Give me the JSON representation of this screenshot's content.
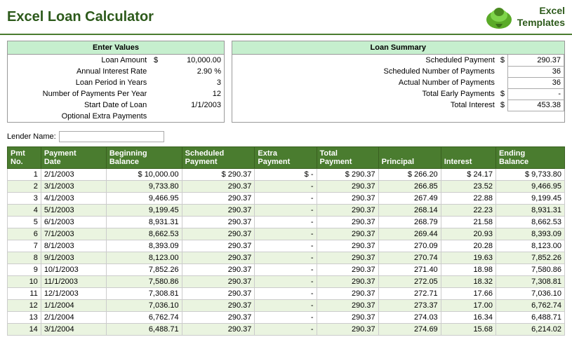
{
  "header": {
    "title": "Excel Loan Calculator",
    "logo_line1": "Excel",
    "logo_line2": "Templates"
  },
  "enter_values": {
    "section_title": "Enter Values",
    "fields": [
      {
        "label": "Loan Amount",
        "dollar": "$",
        "value": "10,000.00"
      },
      {
        "label": "Annual Interest Rate",
        "dollar": "",
        "value": "2.90 %"
      },
      {
        "label": "Loan Period in Years",
        "dollar": "",
        "value": "3"
      },
      {
        "label": "Number of Payments Per Year",
        "dollar": "",
        "value": "12"
      },
      {
        "label": "Start Date of Loan",
        "dollar": "",
        "value": "1/1/2003"
      },
      {
        "label": "Optional Extra Payments",
        "dollar": "",
        "value": ""
      }
    ]
  },
  "loan_summary": {
    "section_title": "Loan Summary",
    "fields": [
      {
        "label": "Scheduled Payment",
        "dollar": "$",
        "value": "290.37"
      },
      {
        "label": "Scheduled Number of Payments",
        "dollar": "",
        "value": "36"
      },
      {
        "label": "Actual Number of Payments",
        "dollar": "",
        "value": "36"
      },
      {
        "label": "Total Early Payments",
        "dollar": "$",
        "value": "-"
      },
      {
        "label": "Total Interest",
        "dollar": "$",
        "value": "453.38"
      }
    ]
  },
  "lender": {
    "label": "Lender Name:",
    "value": ""
  },
  "table": {
    "columns": [
      "Pmt\nNo.",
      "Payment\nDate",
      "Beginning\nBalance",
      "Scheduled\nPayment",
      "Extra\nPayment",
      "Total\nPayment",
      "Principal",
      "Interest",
      "Ending\nBalance"
    ],
    "rows": [
      [
        1,
        "2/1/2003",
        "$ 10,000.00",
        "$ 290.37",
        "$ -",
        "$ 290.37",
        "$ 266.20",
        "$ 24.17",
        "$ 9,733.80"
      ],
      [
        2,
        "3/1/2003",
        "9,733.80",
        "290.37",
        "-",
        "290.37",
        "266.85",
        "23.52",
        "9,466.95"
      ],
      [
        3,
        "4/1/2003",
        "9,466.95",
        "290.37",
        "-",
        "290.37",
        "267.49",
        "22.88",
        "9,199.45"
      ],
      [
        4,
        "5/1/2003",
        "9,199.45",
        "290.37",
        "-",
        "290.37",
        "268.14",
        "22.23",
        "8,931.31"
      ],
      [
        5,
        "6/1/2003",
        "8,931.31",
        "290.37",
        "-",
        "290.37",
        "268.79",
        "21.58",
        "8,662.53"
      ],
      [
        6,
        "7/1/2003",
        "8,662.53",
        "290.37",
        "-",
        "290.37",
        "269.44",
        "20.93",
        "8,393.09"
      ],
      [
        7,
        "8/1/2003",
        "8,393.09",
        "290.37",
        "-",
        "290.37",
        "270.09",
        "20.28",
        "8,123.00"
      ],
      [
        8,
        "9/1/2003",
        "8,123.00",
        "290.37",
        "-",
        "290.37",
        "270.74",
        "19.63",
        "7,852.26"
      ],
      [
        9,
        "10/1/2003",
        "7,852.26",
        "290.37",
        "-",
        "290.37",
        "271.40",
        "18.98",
        "7,580.86"
      ],
      [
        10,
        "11/1/2003",
        "7,580.86",
        "290.37",
        "-",
        "290.37",
        "272.05",
        "18.32",
        "7,308.81"
      ],
      [
        11,
        "12/1/2003",
        "7,308.81",
        "290.37",
        "-",
        "290.37",
        "272.71",
        "17.66",
        "7,036.10"
      ],
      [
        12,
        "1/1/2004",
        "7,036.10",
        "290.37",
        "-",
        "290.37",
        "273.37",
        "17.00",
        "6,762.74"
      ],
      [
        13,
        "2/1/2004",
        "6,762.74",
        "290.37",
        "-",
        "290.37",
        "274.03",
        "16.34",
        "6,488.71"
      ],
      [
        14,
        "3/1/2004",
        "6,488.71",
        "290.37",
        "-",
        "290.37",
        "274.69",
        "15.68",
        "6,214.02"
      ]
    ]
  }
}
